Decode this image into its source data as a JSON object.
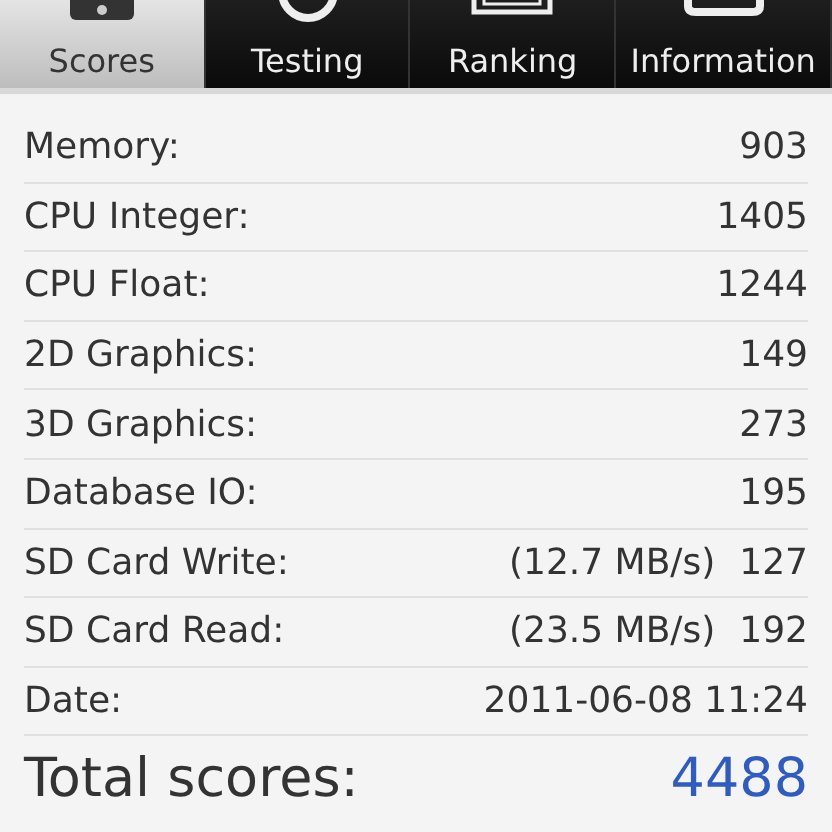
{
  "tabs": [
    {
      "label": "Scores",
      "selected": true
    },
    {
      "label": "Testing",
      "selected": false
    },
    {
      "label": "Ranking",
      "selected": false
    },
    {
      "label": "Information",
      "selected": false
    }
  ],
  "scores": [
    {
      "label": "Memory:",
      "value": "903"
    },
    {
      "label": "CPU Integer:",
      "value": "1405"
    },
    {
      "label": "CPU Float:",
      "value": "1244"
    },
    {
      "label": "2D Graphics:",
      "value": "149"
    },
    {
      "label": "3D Graphics:",
      "value": "273"
    },
    {
      "label": "Database IO:",
      "value": "195"
    },
    {
      "label": "SD Card Write:",
      "speed": "(12.7 MB/s)",
      "value": "127"
    },
    {
      "label": "SD Card Read:",
      "speed": "(23.5 MB/s)",
      "value": "192"
    },
    {
      "label": "Date:",
      "value": "2011-06-08 11:24"
    }
  ],
  "total": {
    "label": "Total scores:",
    "value": "4488"
  }
}
